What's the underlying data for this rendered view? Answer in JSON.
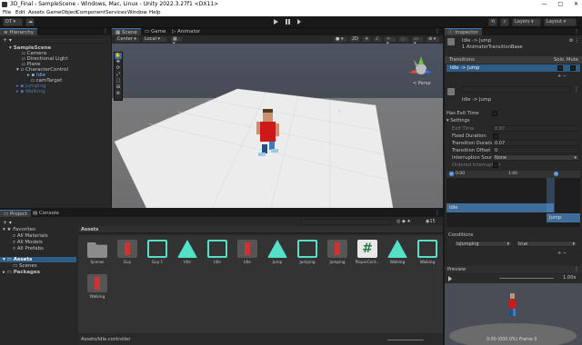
{
  "window": {
    "title": "3D_Final - SampleScene - Windows, Mac, Linux - Unity 2022.3.27f1 <DX11>",
    "controls": [
      "—",
      "□",
      "✕"
    ]
  },
  "menu": [
    "File",
    "Edit",
    "Assets",
    "GameObject",
    "Component",
    "Services",
    "Window",
    "Help"
  ],
  "toolbar": {
    "account": "DT",
    "layers": "Layers",
    "layout": "Layout"
  },
  "hierarchy": {
    "tab": "Hierarchy",
    "search_placeholder": "",
    "items": [
      {
        "label": "SampleScene",
        "depth": 0
      },
      {
        "label": "Camera",
        "depth": 1
      },
      {
        "label": "Directional Light",
        "depth": 1
      },
      {
        "label": "Plane",
        "depth": 1
      },
      {
        "label": "CharacterControl",
        "depth": 1
      },
      {
        "label": "Idle",
        "depth": 2
      },
      {
        "label": "camTarget",
        "depth": 2
      },
      {
        "label": "Jumping",
        "depth": 1
      },
      {
        "label": "Walking",
        "depth": 1
      }
    ]
  },
  "scene": {
    "tabs": [
      "Scene",
      "Game",
      "Animator"
    ],
    "pivot": "Center",
    "space": "Local",
    "mode_2d": "2D",
    "gizmo_label": "< Persp"
  },
  "project": {
    "tabs": [
      "Project",
      "Console"
    ],
    "count": "15",
    "favorites_header": "Favorites",
    "favorites": [
      "All Materials",
      "All Models",
      "All Prefabs"
    ],
    "assets_header": "Assets",
    "asset_folders": [
      "Scenes",
      "Packages"
    ],
    "breadcrumb": "Assets",
    "assets": [
      {
        "name": "Scenes",
        "kind": "folder"
      },
      {
        "name": "Guy",
        "kind": "model"
      },
      {
        "name": "Guy 1",
        "kind": "controller"
      },
      {
        "name": "Idle",
        "kind": "clip"
      },
      {
        "name": "Idle",
        "kind": "controller"
      },
      {
        "name": "Idle",
        "kind": "model"
      },
      {
        "name": "Jump",
        "kind": "clip"
      },
      {
        "name": "Jumping",
        "kind": "controller"
      },
      {
        "name": "Jumping",
        "kind": "model"
      },
      {
        "name": "PlayerCont...",
        "kind": "script"
      },
      {
        "name": "Walking",
        "kind": "clip"
      },
      {
        "name": "Walking",
        "kind": "controller"
      },
      {
        "name": "Walking",
        "kind": "model"
      }
    ],
    "status_path": "Assets/Idle.controller"
  },
  "inspector": {
    "tab": "Inspector",
    "header_title": "Idle -> Jump",
    "header_sub": "1 AnimatorTransitionBase",
    "transitions_label": "Transitions",
    "solo": "Solo",
    "mute": "Mute",
    "transition_item": "Idle -> Jump",
    "name_field": "",
    "transition_name": "Idle -> Jump",
    "has_exit_time": "Has Exit Time",
    "settings": "Settings",
    "fields": [
      {
        "label": "Exit Time",
        "value": "0.97",
        "dim": true
      },
      {
        "label": "Fixed Duration",
        "value": "",
        "dim": false
      },
      {
        "label": "Transition Duration",
        "value": "0.07",
        "dim": false
      },
      {
        "label": "Transition Offset",
        "value": "0",
        "dim": false
      },
      {
        "label": "Interruption Source",
        "value": "None",
        "dim": false
      },
      {
        "label": "Ordered Interruption",
        "value": "",
        "dim": true
      }
    ],
    "timeline_ticks": [
      "0:00",
      "1:00"
    ],
    "timeline_bars": [
      "Idle",
      "Jump"
    ],
    "conditions_label": "Conditions",
    "condition_param": "IsJumping",
    "condition_value": "true",
    "preview_label": "Preview",
    "preview_speed": "1.00x",
    "preview_status": "0:00 (000.0%) Frame 0"
  },
  "colors": {
    "accent": "#3a79bb",
    "teal_icon": "#55e0c8",
    "panel": "#282828",
    "dark": "#191919"
  }
}
